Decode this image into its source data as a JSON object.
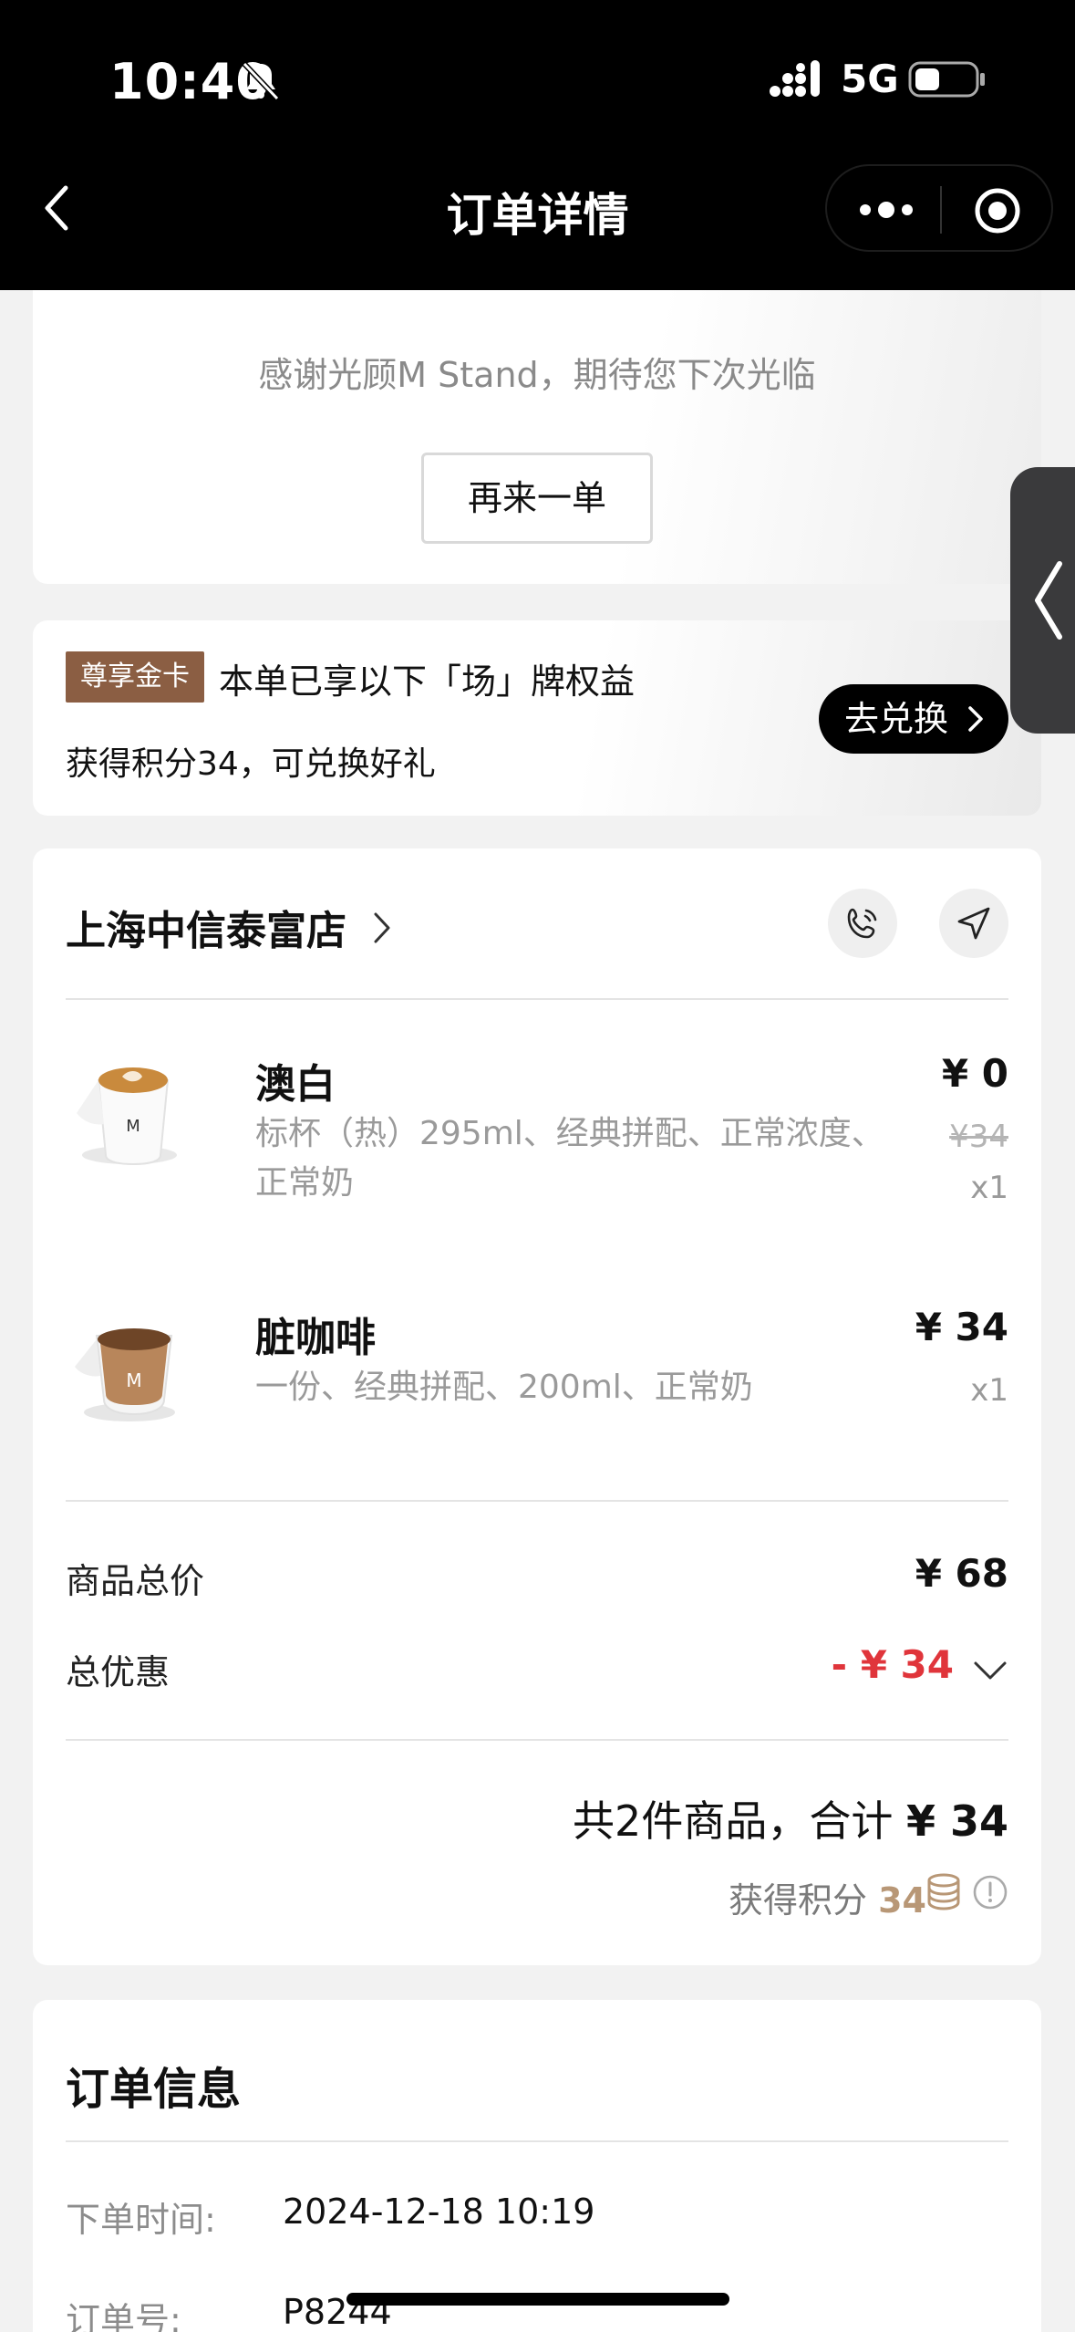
{
  "status_bar": {
    "time": "10:40",
    "network": "5G"
  },
  "nav": {
    "title": "订单详情"
  },
  "thanks_card": {
    "message": "感谢光顾M Stand，期待您下次光临",
    "reorder_label": "再来一单"
  },
  "member_card": {
    "badge": "尊享金卡",
    "benefit_text": "本单已享以下「场」牌权益",
    "points_text": "获得积分34，可兑换好礼",
    "exchange_label": "去兑换"
  },
  "order": {
    "store_name": "上海中信泰富店",
    "items": [
      {
        "name": "澳白",
        "spec": "标杯（热）295ml、经典拼配、正常浓度、正常奶",
        "price": "¥ 0",
        "original_price": "¥34",
        "qty": "x1"
      },
      {
        "name": "脏咖啡",
        "spec": "一份、经典拼配、200ml、正常奶",
        "price": "¥ 34",
        "qty": "x1"
      }
    ],
    "subtotal_label": "商品总价",
    "subtotal": "¥ 68",
    "discount_label": "总优惠",
    "discount": "- ¥ 34",
    "total_prefix": "共2件商品，合计",
    "total": "¥ 34",
    "earn_label": "获得积分",
    "earn_points": "34"
  },
  "order_info": {
    "title": "订单信息",
    "time_label": "下单时间:",
    "time_value": "2024-12-18 10:19",
    "no_label": "订单号:",
    "no_value": "P8244"
  }
}
